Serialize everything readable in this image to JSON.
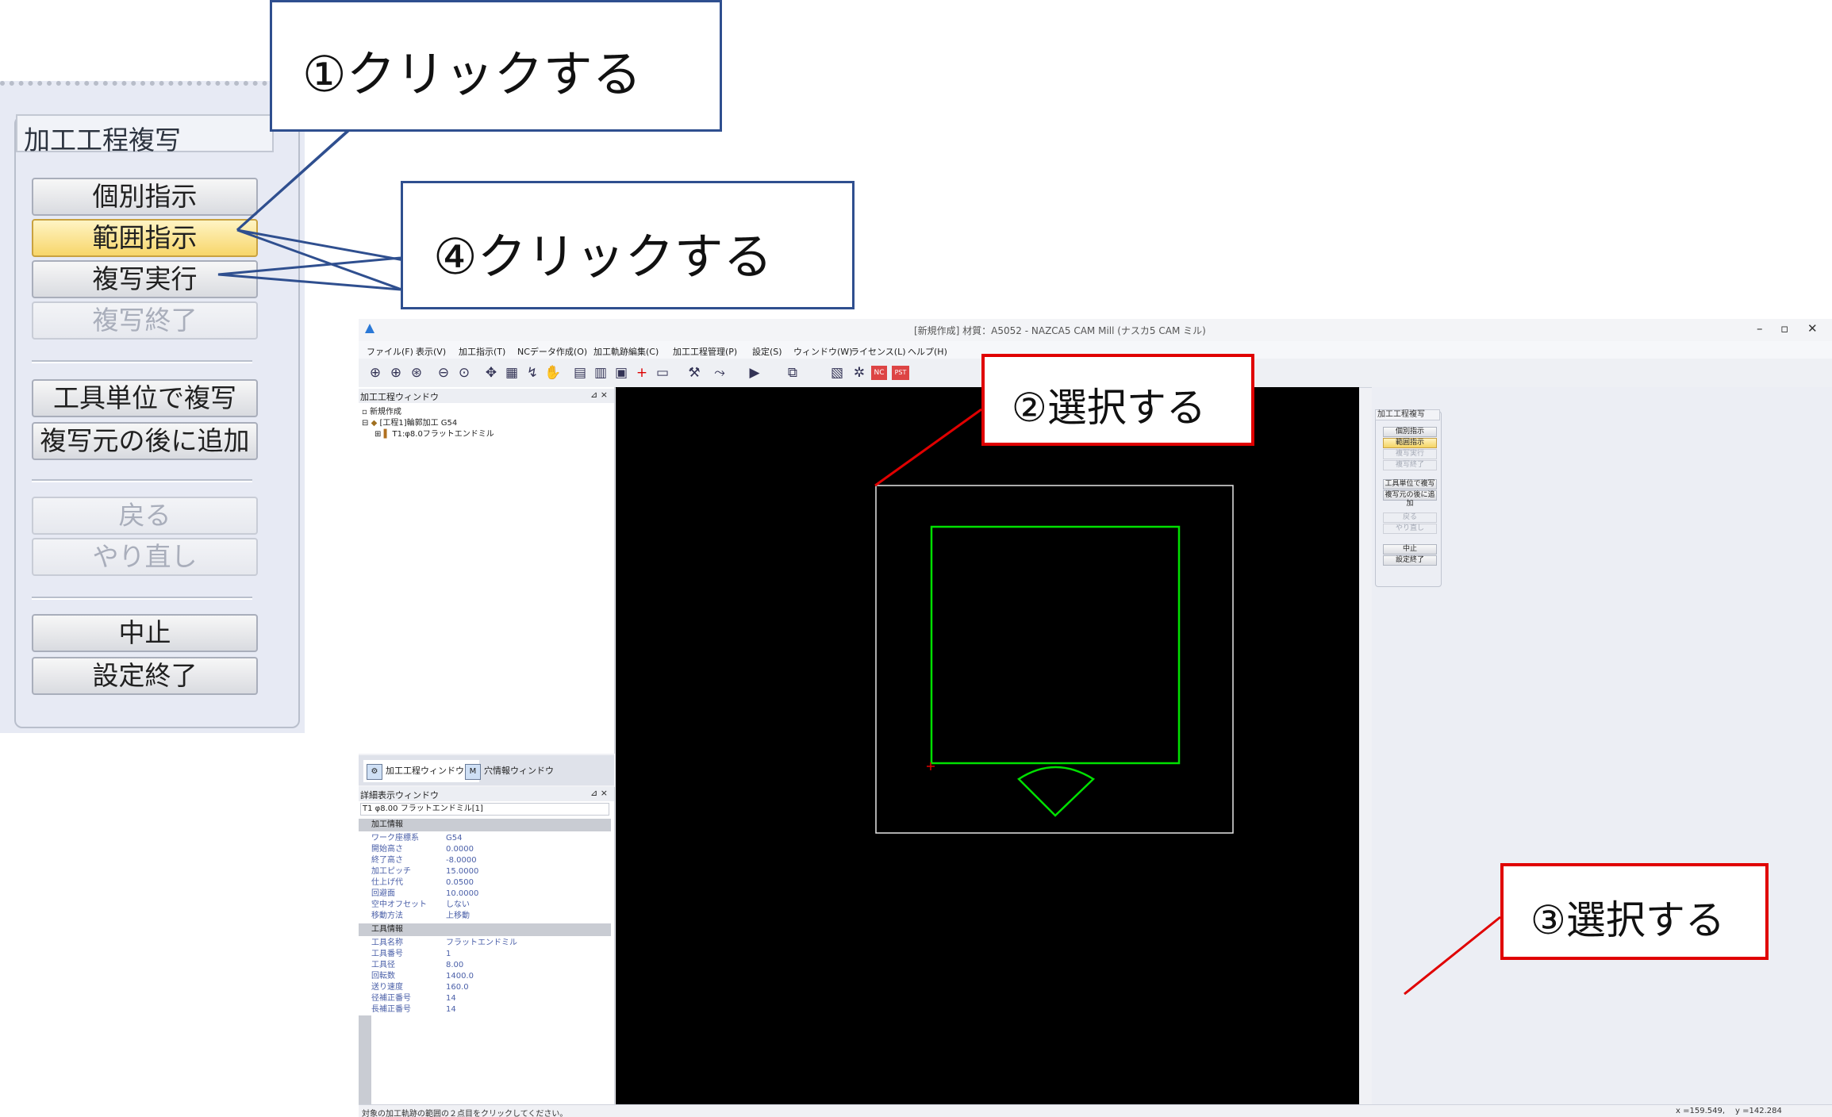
{
  "zoom_panel": {
    "title": "加工工程複写",
    "buttons": [
      {
        "label": "個別指示",
        "state": "normal"
      },
      {
        "label": "範囲指示",
        "state": "active"
      },
      {
        "label": "複写実行",
        "state": "normal"
      },
      {
        "label": "複写終了",
        "state": "disabled"
      },
      {
        "label": "工具単位で複写",
        "state": "normal"
      },
      {
        "label": "複写元の後に追加",
        "state": "normal"
      },
      {
        "label": "戻る",
        "state": "disabled"
      },
      {
        "label": "やり直し",
        "state": "disabled"
      },
      {
        "label": "中止",
        "state": "normal"
      },
      {
        "label": "設定終了",
        "state": "normal"
      }
    ]
  },
  "callouts": {
    "c1": "①クリックする",
    "c2": "②選択する",
    "c3": "③選択する",
    "c4": "④クリックする"
  },
  "app": {
    "title": "[新規作成] 材質：A5052 - NAZCA5 CAM Mill (ナスカ5 CAM ミル)",
    "window_controls": {
      "min": "–",
      "max": "▫",
      "close": "✕"
    },
    "menu": [
      "ファイル(F)",
      "表示(V)",
      "加工指示(T)",
      "NCデータ作成(O)",
      "加工軌跡編集(C)",
      "加工工程管理(P)",
      "設定(S)",
      "ウィンドウ(W)",
      "ライセンス(L)",
      "ヘルプ(H)"
    ],
    "toolbar_icons": [
      "zoom-in-icon",
      "zoom-window-icon",
      "zoom-all-icon",
      "zoom-out-icon",
      "zoom-prev-icon",
      "pan-icon",
      "view-icon",
      "rotate-icon",
      "hand-icon",
      "layer-icon",
      "grid-icon",
      "print-icon",
      "origin-icon",
      "measure-icon",
      "tool-icon",
      "path-icon",
      "sim-icon",
      "nc-icon",
      "copy-icon",
      "ref-icon",
      "nc-badge-icon",
      "pst-badge-icon"
    ],
    "toolbar_badges": {
      "nc": "NC",
      "pst": "PST"
    },
    "process_window": {
      "title": "加工工程ウィンドウ",
      "tree": [
        "新規作成",
        "[工程1]輪郭加工 G54",
        "T1:φ8.0フラットエンドミル"
      ]
    },
    "tabs": [
      "加工工程ウィンドウ",
      "穴情報ウィンドウ"
    ],
    "detail_window": {
      "title": "詳細表示ウィンドウ",
      "combo": "T1 φ8.00 フラットエンドミル[1]",
      "sections": [
        {
          "name": "加工情報",
          "rows": [
            [
              "ワーク座標系",
              "G54"
            ],
            [
              "開始高さ",
              "0.0000"
            ],
            [
              "終了高さ",
              "-8.0000"
            ],
            [
              "加工ピッチ",
              "15.0000"
            ],
            [
              "仕上げ代",
              "0.0500"
            ],
            [
              "回避面",
              "10.0000"
            ],
            [
              "空中オフセット",
              "しない"
            ],
            [
              "移動方法",
              "上移動"
            ]
          ]
        },
        {
          "name": "工具情報",
          "rows": [
            [
              "工具名称",
              "フラットエンドミル"
            ],
            [
              "工具番号",
              "1"
            ],
            [
              "工具径",
              "8.00"
            ],
            [
              "回転数",
              "1400.0"
            ],
            [
              "送り速度",
              "160.0"
            ],
            [
              "径補正番号",
              "14"
            ],
            [
              "長補正番号",
              "14"
            ]
          ]
        }
      ]
    },
    "side_panel": {
      "title": "加工工程複写",
      "buttons": [
        {
          "label": "個別指示",
          "state": "normal"
        },
        {
          "label": "範囲指示",
          "state": "active"
        },
        {
          "label": "複写実行",
          "state": "disabled"
        },
        {
          "label": "複写終了",
          "state": "disabled"
        },
        {
          "label": "工具単位で複写",
          "state": "normal"
        },
        {
          "label": "複写元の後に追加",
          "state": "normal"
        },
        {
          "label": "戻る",
          "state": "disabled"
        },
        {
          "label": "やり直し",
          "state": "disabled"
        },
        {
          "label": "中止",
          "state": "normal"
        },
        {
          "label": "設定終了",
          "state": "normal"
        }
      ]
    },
    "status": {
      "message": "対象の加工軌跡の範囲の２点目をクリックしてください。",
      "x": "x =159.549,",
      "y": "y =142.284"
    }
  },
  "colors": {
    "callout_blue": "#2f4f8f",
    "callout_red": "#e00000",
    "path_green": "#00e000",
    "selection_white": "#e6e6e6",
    "canvas_bg": "#000000"
  }
}
